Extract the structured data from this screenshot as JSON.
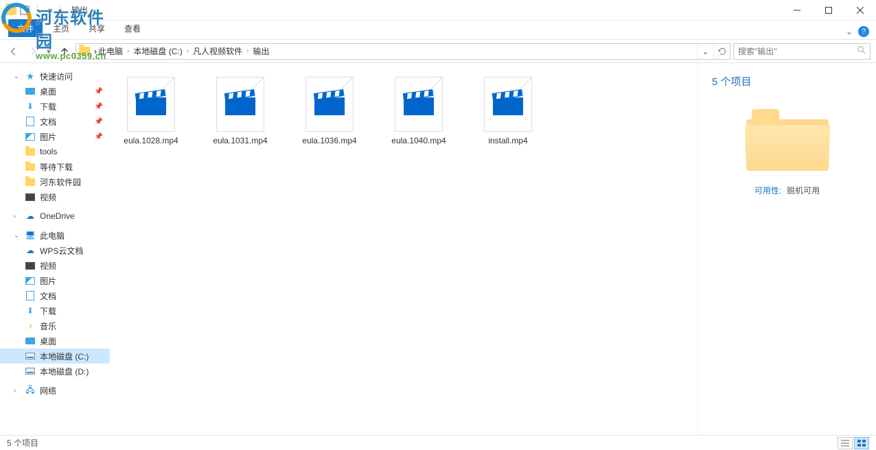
{
  "window": {
    "title": "输出"
  },
  "ribbon": {
    "tabs": {
      "file": "文件",
      "home": "主页",
      "share": "共享",
      "view": "查看"
    }
  },
  "breadcrumb": {
    "items": [
      "此电脑",
      "本地磁盘 (C:)",
      "凡人视频软件",
      "输出"
    ]
  },
  "search": {
    "placeholder": "搜索\"输出\""
  },
  "sidebar": {
    "quick": "快速访问",
    "desktop": "桌面",
    "downloads": "下载",
    "documents": "文档",
    "pictures": "图片",
    "tools": "tools",
    "waitdl": "等待下载",
    "hedong": "河东软件园",
    "video": "视频",
    "onedrive": "OneDrive",
    "thispc": "此电脑",
    "wps": "WPS云文档",
    "video2": "视频",
    "pictures2": "图片",
    "documents2": "文档",
    "downloads2": "下载",
    "music": "音乐",
    "desktop2": "桌面",
    "drivec": "本地磁盘 (C:)",
    "drived": "本地磁盘 (D:)",
    "network": "网络"
  },
  "files": [
    {
      "name": "eula.1028.mp4"
    },
    {
      "name": "eula.1031.mp4"
    },
    {
      "name": "eula.1036.mp4"
    },
    {
      "name": "eula.1040.mp4"
    },
    {
      "name": "install.mp4"
    }
  ],
  "details": {
    "count": "5 个项目",
    "avail_key": "可用性:",
    "avail_val": "脱机可用"
  },
  "status": {
    "text": "5 个项目"
  },
  "watermark": {
    "cn": "河东软件园",
    "url": "www.pc0359.cn"
  }
}
